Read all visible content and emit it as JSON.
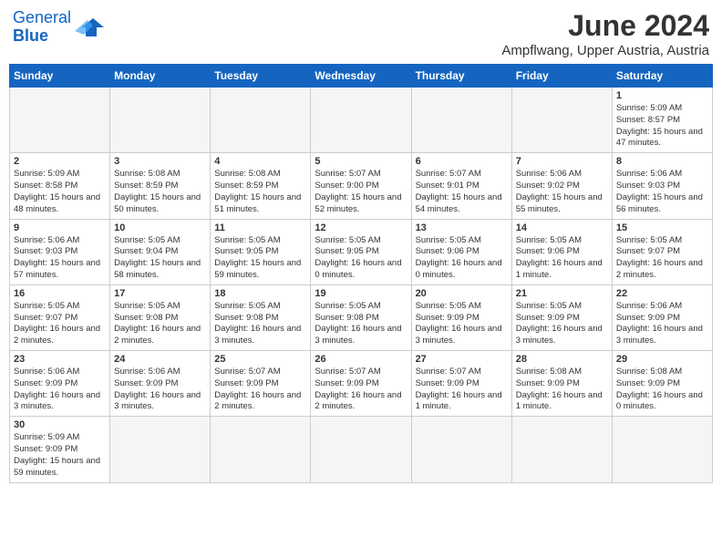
{
  "header": {
    "logo_general": "General",
    "logo_blue": "Blue",
    "month": "June 2024",
    "location": "Ampflwang, Upper Austria, Austria"
  },
  "weekdays": [
    "Sunday",
    "Monday",
    "Tuesday",
    "Wednesday",
    "Thursday",
    "Friday",
    "Saturday"
  ],
  "weeks": [
    [
      {
        "num": "",
        "info": "",
        "empty": true
      },
      {
        "num": "",
        "info": "",
        "empty": true
      },
      {
        "num": "",
        "info": "",
        "empty": true
      },
      {
        "num": "",
        "info": "",
        "empty": true
      },
      {
        "num": "",
        "info": "",
        "empty": true
      },
      {
        "num": "",
        "info": "",
        "empty": true
      },
      {
        "num": "1",
        "info": "Sunrise: 5:09 AM\nSunset: 8:57 PM\nDaylight: 15 hours and 47 minutes.",
        "empty": false
      }
    ],
    [
      {
        "num": "2",
        "info": "Sunrise: 5:09 AM\nSunset: 8:58 PM\nDaylight: 15 hours and 48 minutes.",
        "empty": false
      },
      {
        "num": "3",
        "info": "Sunrise: 5:08 AM\nSunset: 8:59 PM\nDaylight: 15 hours and 50 minutes.",
        "empty": false
      },
      {
        "num": "4",
        "info": "Sunrise: 5:08 AM\nSunset: 8:59 PM\nDaylight: 15 hours and 51 minutes.",
        "empty": false
      },
      {
        "num": "5",
        "info": "Sunrise: 5:07 AM\nSunset: 9:00 PM\nDaylight: 15 hours and 52 minutes.",
        "empty": false
      },
      {
        "num": "6",
        "info": "Sunrise: 5:07 AM\nSunset: 9:01 PM\nDaylight: 15 hours and 54 minutes.",
        "empty": false
      },
      {
        "num": "7",
        "info": "Sunrise: 5:06 AM\nSunset: 9:02 PM\nDaylight: 15 hours and 55 minutes.",
        "empty": false
      },
      {
        "num": "8",
        "info": "Sunrise: 5:06 AM\nSunset: 9:03 PM\nDaylight: 15 hours and 56 minutes.",
        "empty": false
      }
    ],
    [
      {
        "num": "9",
        "info": "Sunrise: 5:06 AM\nSunset: 9:03 PM\nDaylight: 15 hours and 57 minutes.",
        "empty": false
      },
      {
        "num": "10",
        "info": "Sunrise: 5:05 AM\nSunset: 9:04 PM\nDaylight: 15 hours and 58 minutes.",
        "empty": false
      },
      {
        "num": "11",
        "info": "Sunrise: 5:05 AM\nSunset: 9:05 PM\nDaylight: 15 hours and 59 minutes.",
        "empty": false
      },
      {
        "num": "12",
        "info": "Sunrise: 5:05 AM\nSunset: 9:05 PM\nDaylight: 16 hours and 0 minutes.",
        "empty": false
      },
      {
        "num": "13",
        "info": "Sunrise: 5:05 AM\nSunset: 9:06 PM\nDaylight: 16 hours and 0 minutes.",
        "empty": false
      },
      {
        "num": "14",
        "info": "Sunrise: 5:05 AM\nSunset: 9:06 PM\nDaylight: 16 hours and 1 minute.",
        "empty": false
      },
      {
        "num": "15",
        "info": "Sunrise: 5:05 AM\nSunset: 9:07 PM\nDaylight: 16 hours and 2 minutes.",
        "empty": false
      }
    ],
    [
      {
        "num": "16",
        "info": "Sunrise: 5:05 AM\nSunset: 9:07 PM\nDaylight: 16 hours and 2 minutes.",
        "empty": false
      },
      {
        "num": "17",
        "info": "Sunrise: 5:05 AM\nSunset: 9:08 PM\nDaylight: 16 hours and 2 minutes.",
        "empty": false
      },
      {
        "num": "18",
        "info": "Sunrise: 5:05 AM\nSunset: 9:08 PM\nDaylight: 16 hours and 3 minutes.",
        "empty": false
      },
      {
        "num": "19",
        "info": "Sunrise: 5:05 AM\nSunset: 9:08 PM\nDaylight: 16 hours and 3 minutes.",
        "empty": false
      },
      {
        "num": "20",
        "info": "Sunrise: 5:05 AM\nSunset: 9:09 PM\nDaylight: 16 hours and 3 minutes.",
        "empty": false
      },
      {
        "num": "21",
        "info": "Sunrise: 5:05 AM\nSunset: 9:09 PM\nDaylight: 16 hours and 3 minutes.",
        "empty": false
      },
      {
        "num": "22",
        "info": "Sunrise: 5:06 AM\nSunset: 9:09 PM\nDaylight: 16 hours and 3 minutes.",
        "empty": false
      }
    ],
    [
      {
        "num": "23",
        "info": "Sunrise: 5:06 AM\nSunset: 9:09 PM\nDaylight: 16 hours and 3 minutes.",
        "empty": false
      },
      {
        "num": "24",
        "info": "Sunrise: 5:06 AM\nSunset: 9:09 PM\nDaylight: 16 hours and 3 minutes.",
        "empty": false
      },
      {
        "num": "25",
        "info": "Sunrise: 5:07 AM\nSunset: 9:09 PM\nDaylight: 16 hours and 2 minutes.",
        "empty": false
      },
      {
        "num": "26",
        "info": "Sunrise: 5:07 AM\nSunset: 9:09 PM\nDaylight: 16 hours and 2 minutes.",
        "empty": false
      },
      {
        "num": "27",
        "info": "Sunrise: 5:07 AM\nSunset: 9:09 PM\nDaylight: 16 hours and 1 minute.",
        "empty": false
      },
      {
        "num": "28",
        "info": "Sunrise: 5:08 AM\nSunset: 9:09 PM\nDaylight: 16 hours and 1 minute.",
        "empty": false
      },
      {
        "num": "29",
        "info": "Sunrise: 5:08 AM\nSunset: 9:09 PM\nDaylight: 16 hours and 0 minutes.",
        "empty": false
      }
    ],
    [
      {
        "num": "30",
        "info": "Sunrise: 5:09 AM\nSunset: 9:09 PM\nDaylight: 15 hours and 59 minutes.",
        "empty": false
      },
      {
        "num": "",
        "info": "",
        "empty": true
      },
      {
        "num": "",
        "info": "",
        "empty": true
      },
      {
        "num": "",
        "info": "",
        "empty": true
      },
      {
        "num": "",
        "info": "",
        "empty": true
      },
      {
        "num": "",
        "info": "",
        "empty": true
      },
      {
        "num": "",
        "info": "",
        "empty": true
      }
    ]
  ]
}
